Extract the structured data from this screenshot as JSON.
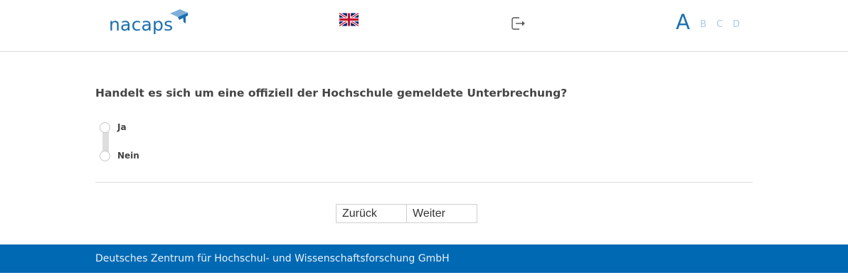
{
  "header": {
    "logo_text": "nacaps",
    "language_flag": "uk-flag-icon",
    "exit_icon": "exit-icon",
    "font_sizes": [
      "A",
      "B",
      "C",
      "D"
    ]
  },
  "question": {
    "text": "Handelt es sich um eine offiziell der Hochschule gemeldete Unterbrechung?",
    "options": [
      {
        "label": "Ja",
        "selected": false
      },
      {
        "label": "Nein",
        "selected": false
      }
    ]
  },
  "nav": {
    "back_label": "Zurück",
    "next_label": "Weiter"
  },
  "footer": {
    "text": "Deutsches Zentrum für Hochschul- und Wissenschaftsforschung GmbH"
  },
  "colors": {
    "brand": "#1a6fae",
    "footer_bg": "#0069b4",
    "text": "#444444"
  }
}
